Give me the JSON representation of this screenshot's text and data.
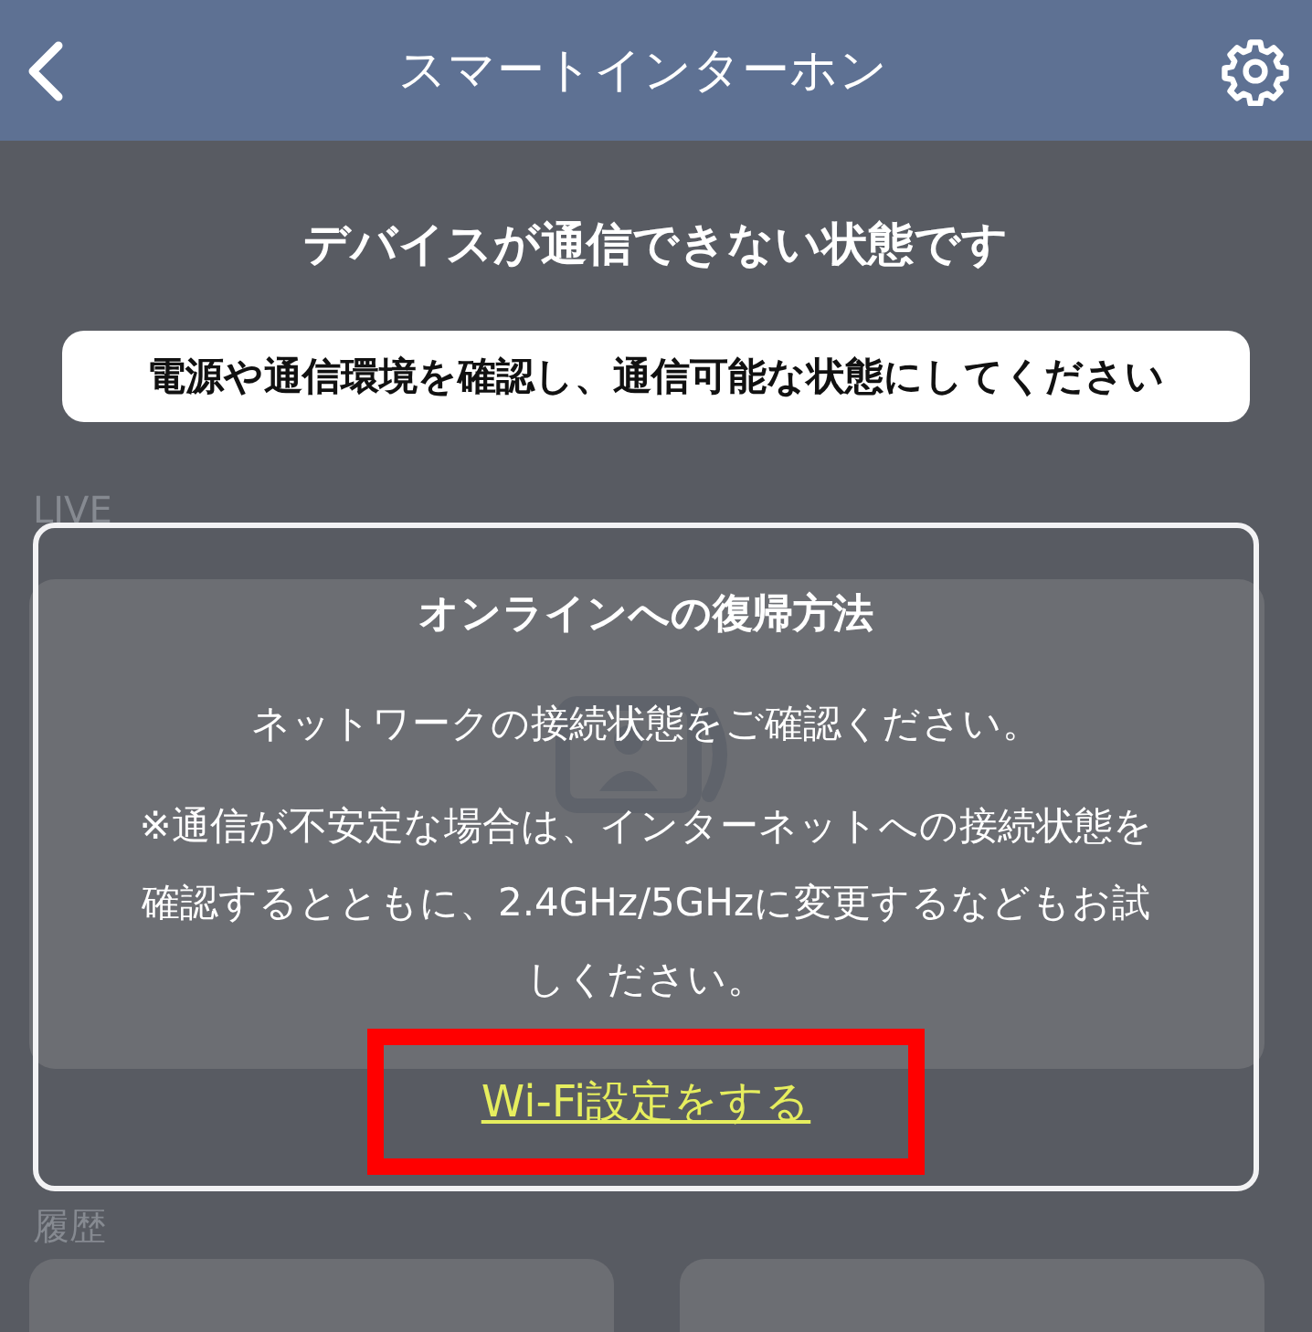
{
  "header": {
    "title": "スマートインターホン"
  },
  "status": {
    "title": "デバイスが通信できない状態です",
    "message": "電源や通信環境を確認し、通信可能な状態にしてください"
  },
  "live": {
    "label": "LIVE"
  },
  "history": {
    "label": "履歴"
  },
  "dialog": {
    "title": "オンラインへの復帰方法",
    "paragraphs": [
      "ネットワークの接続状態をご確認ください。",
      "※通信が不安定な場合は、インターネットへの接続状態を確認するとともに、2.4GHz/5GHzに変更するなどもお試しください。"
    ],
    "link": "Wi-Fi設定をする",
    "link_highlighted": true
  }
}
